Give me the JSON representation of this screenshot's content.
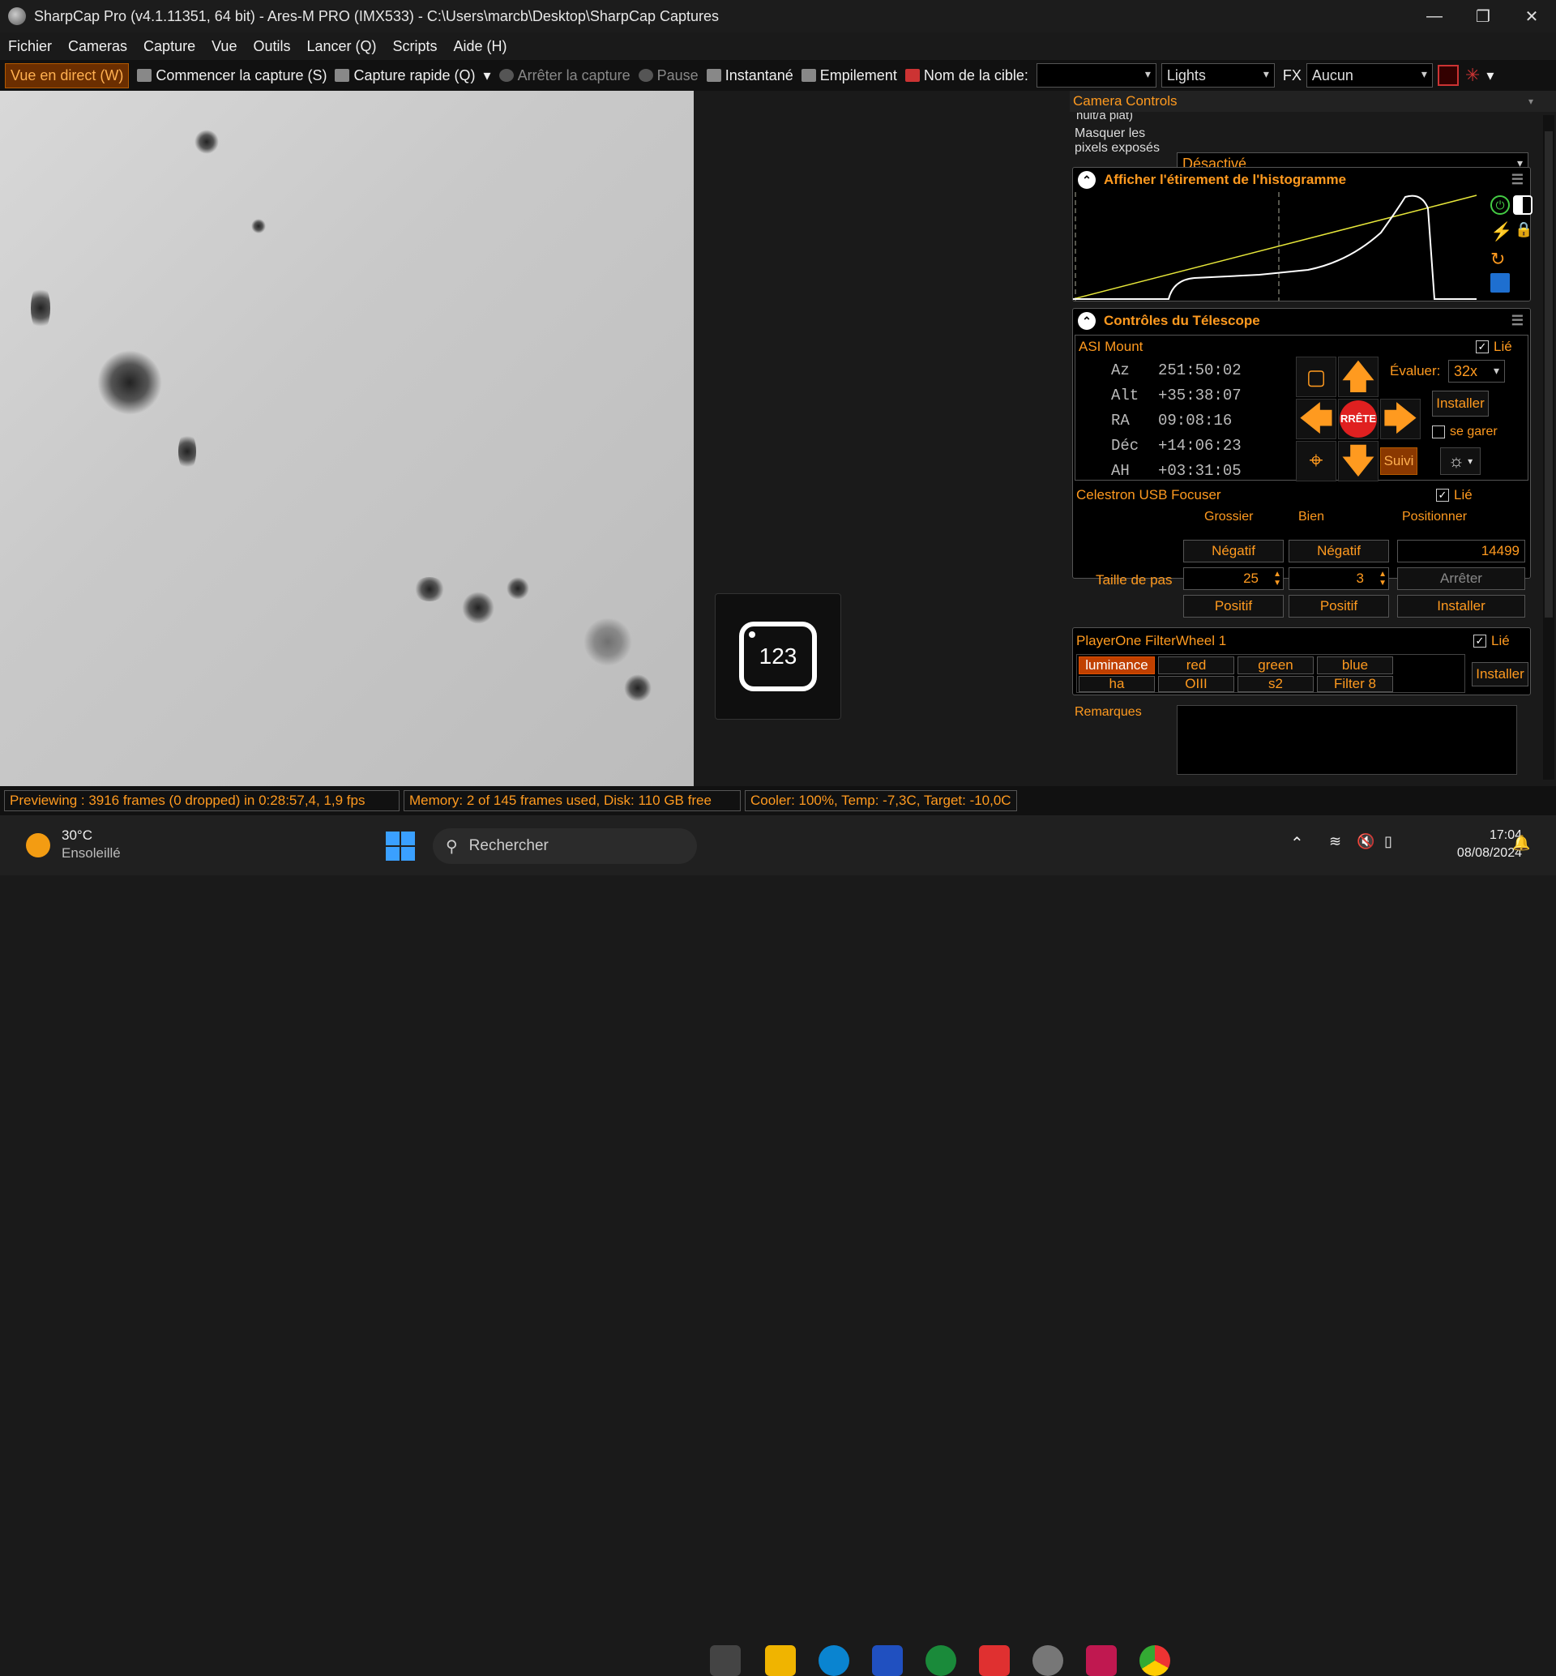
{
  "window": {
    "title": "SharpCap Pro (v4.1.11351, 64 bit) - Ares-M PRO (IMX533) - C:\\Users\\marcb\\Desktop\\SharpCap Captures"
  },
  "menu": [
    "Fichier",
    "Cameras",
    "Capture",
    "Vue",
    "Outils",
    "Lancer (Q)",
    "Scripts",
    "Aide (H)"
  ],
  "toolbar": {
    "live": "Vue en direct (W)",
    "start": "Commencer la capture (S)",
    "quick": "Capture rapide (Q)",
    "stop": "Arrêter la capture",
    "pause": "Pause",
    "snapshot": "Instantané",
    "stacking": "Empilement",
    "target_label": "Nom de la cible:",
    "target_value": "",
    "frame_type": "Lights",
    "fx_label": "FX",
    "fx_value": "Aucun"
  },
  "ocr_overlay": {
    "text": "123"
  },
  "camera_controls": {
    "title": "Camera Controls",
    "cut_label": "nuit/à plat)",
    "mask_label_1": "Masquer les",
    "mask_label_2": "pixels exposés",
    "mask_value": "Désactivé"
  },
  "histogram": {
    "title": "Afficher l'étirement de l'histogramme"
  },
  "telescope": {
    "title": "Contrôles du Télescope",
    "mount_name": "ASI Mount",
    "linked": "Lié",
    "coords": [
      {
        "label": "Az",
        "value": "251:50:02"
      },
      {
        "label": "Alt",
        "value": "+35:38:07"
      },
      {
        "label": "RA",
        "value": "09:08:16"
      },
      {
        "label": "Déc",
        "value": "+14:06:23"
      },
      {
        "label": "AH",
        "value": "+03:31:05"
      }
    ],
    "stop": "RRÊTE",
    "rate_label": "Évaluer:",
    "rate_value": "32x",
    "install": "Installer",
    "park": "se garer",
    "track": "Suivi"
  },
  "focuser": {
    "name": "Celestron USB Focuser",
    "linked": "Lié",
    "col_coarse": "Grossier",
    "col_fine": "Bien",
    "col_position": "Positionner",
    "negative": "Négatif",
    "positive": "Positif",
    "step_label": "Taille de pas",
    "coarse_step": "25",
    "fine_step": "3",
    "position": "14499",
    "stop": "Arrêter",
    "install": "Installer"
  },
  "filterwheel": {
    "name": "PlayerOne FilterWheel 1",
    "linked": "Lié",
    "filters": [
      "luminance",
      "red",
      "green",
      "blue",
      "ha",
      "OIII",
      "s2",
      "Filter 8"
    ],
    "install": "Installer"
  },
  "notes": {
    "label": "Remarques"
  },
  "status": {
    "preview": "Previewing : 3916 frames (0 dropped) in 0:28:57,4, 1,9 fps",
    "memory": "Memory: 2 of 145 frames used, Disk: 110 GB free",
    "cooler": "Cooler: 100%, Temp: -7,3C, Target: -10,0C"
  },
  "taskbar": {
    "weather_temp": "30°C",
    "weather_desc": "Ensoleillé",
    "search": "Rechercher",
    "time": "17:04",
    "date": "08/08/2024"
  }
}
